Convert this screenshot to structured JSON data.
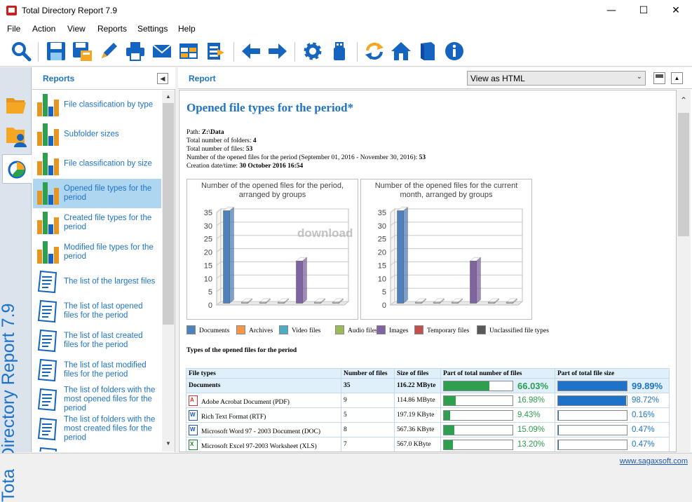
{
  "window": {
    "title": "Total Directory Report 7.9"
  },
  "menu": [
    "File",
    "Action",
    "View",
    "Reports",
    "Settings",
    "Help"
  ],
  "toolbar_icons": [
    "search-icon",
    "save-icon",
    "save-as-icon",
    "edit-icon",
    "print-icon",
    "email-icon",
    "table-icon",
    "export-icon",
    "back-icon",
    "forward-icon",
    "settings-icon",
    "usb-icon",
    "refresh-icon",
    "home-icon",
    "book-icon",
    "info-icon"
  ],
  "sidebar": {
    "vertical_title": "Total Directory Report  7.9"
  },
  "reports_panel": {
    "title": "Reports",
    "items": [
      {
        "label": "File classification by type",
        "icon": "bars",
        "selected": false
      },
      {
        "label": "Subfolder sizes",
        "icon": "bars",
        "selected": false
      },
      {
        "label": "File classification by size",
        "icon": "bars",
        "selected": false
      },
      {
        "label": "Opened file types for the period",
        "icon": "bars",
        "selected": true
      },
      {
        "label": "Created file types for the period",
        "icon": "bars",
        "selected": false
      },
      {
        "label": "Modified file types for the period",
        "icon": "bars",
        "selected": false
      },
      {
        "label": "The list of the largest files",
        "icon": "doc",
        "selected": false
      },
      {
        "label": "The list of last opened files for the period",
        "icon": "doc",
        "selected": false
      },
      {
        "label": "The list of last created files for the period",
        "icon": "doc",
        "selected": false
      },
      {
        "label": "The list of last modified files for the period",
        "icon": "doc",
        "selected": false
      },
      {
        "label": "The list of folders with the most opened files for the period",
        "icon": "doc",
        "selected": false
      },
      {
        "label": "The list of folders with the most created files for the period",
        "icon": "doc",
        "selected": false
      },
      {
        "label": "The list of folders with the",
        "icon": "doc",
        "selected": false
      }
    ]
  },
  "report_panel": {
    "title": "Report",
    "view_mode": "View as HTML"
  },
  "report": {
    "title": "Opened file types for the period*",
    "info": [
      {
        "label": "Path: ",
        "value": "Z:\\Data"
      },
      {
        "label": "Total number of folders: ",
        "value": "4"
      },
      {
        "label": "Total number of files: ",
        "value": "53"
      },
      {
        "label": "Number of the opened files for the period (September 01, 2016 - November 30, 2016): ",
        "value": "53"
      },
      {
        "label": "Creation date/time: ",
        "value": "30 October 2016 16:54"
      }
    ],
    "legend": [
      {
        "name": "Documents",
        "color": "#4f81bd"
      },
      {
        "name": "Archives",
        "color": "#f79646"
      },
      {
        "name": "Video files",
        "color": "#4bacc6"
      },
      {
        "name": "Audio files",
        "color": "#9bbb59"
      },
      {
        "name": "Images",
        "color": "#8064a2"
      },
      {
        "name": "Temporary files",
        "color": "#c0504d"
      },
      {
        "name": "Unclassified file types",
        "color": "#595959"
      }
    ],
    "table_title": "Types of the opened files for the period",
    "table_headers": [
      "File types",
      "Number of files",
      "Size of files",
      "Part of total number of files",
      "Part of total file size"
    ],
    "rows": [
      {
        "type": "Documents",
        "count": "35",
        "size": "116.22 MByte",
        "pct_count": "66.03%",
        "frac_count": 0.6603,
        "pct_size": "99.89%",
        "frac_size": 0.9989,
        "group": true
      },
      {
        "type": "Adobe Acrobat Document (PDF)",
        "icon": "pdf",
        "count": "9",
        "size": "114.86 MByte",
        "pct_count": "16.98%",
        "frac_count": 0.1698,
        "pct_size": "98.72%",
        "frac_size": 0.9872
      },
      {
        "type": "Rich Text Format (RTF)",
        "icon": "word",
        "count": "5",
        "size": "197.19 KByte",
        "pct_count": "9.43%",
        "frac_count": 0.0943,
        "pct_size": "0.16%",
        "frac_size": 0.0016
      },
      {
        "type": "Microsoft Word 97 - 2003 Document (DOC)",
        "icon": "word",
        "count": "8",
        "size": "567.36 KByte",
        "pct_count": "15.09%",
        "frac_count": 0.1509,
        "pct_size": "0.47%",
        "frac_size": 0.0047
      },
      {
        "type": "Microsoft Excel 97-2003 Worksheet (XLS)",
        "icon": "excel",
        "count": "7",
        "size": "567.0 KByte",
        "pct_count": "13.20%",
        "frac_count": 0.132,
        "pct_size": "0.47%",
        "frac_size": 0.0047
      }
    ]
  },
  "chart_data": [
    {
      "type": "bar",
      "title": "Number of the opened files for the period, arranged by groups",
      "categories": [
        "Documents",
        "Archives",
        "Video files",
        "Audio files",
        "Images",
        "Temporary files",
        "Unclassified file types"
      ],
      "values": [
        35,
        0,
        0,
        0,
        16,
        0,
        0
      ],
      "ylim": [
        0,
        35
      ],
      "yticks": [
        0,
        5,
        10,
        15,
        20,
        25,
        30,
        35
      ],
      "grid": true
    },
    {
      "type": "bar",
      "title": "Number of the opened files for the current month, arranged by groups",
      "categories": [
        "Documents",
        "Archives",
        "Video files",
        "Audio files",
        "Images",
        "Temporary files",
        "Unclassified file types"
      ],
      "values": [
        35,
        0,
        0,
        0,
        16,
        0,
        0
      ],
      "ylim": [
        0,
        35
      ],
      "yticks": [
        0,
        5,
        10,
        15,
        20,
        25,
        30,
        35
      ],
      "grid": true
    }
  ],
  "watermark": "download",
  "status": {
    "link": "www.sagaxsoft.com"
  }
}
